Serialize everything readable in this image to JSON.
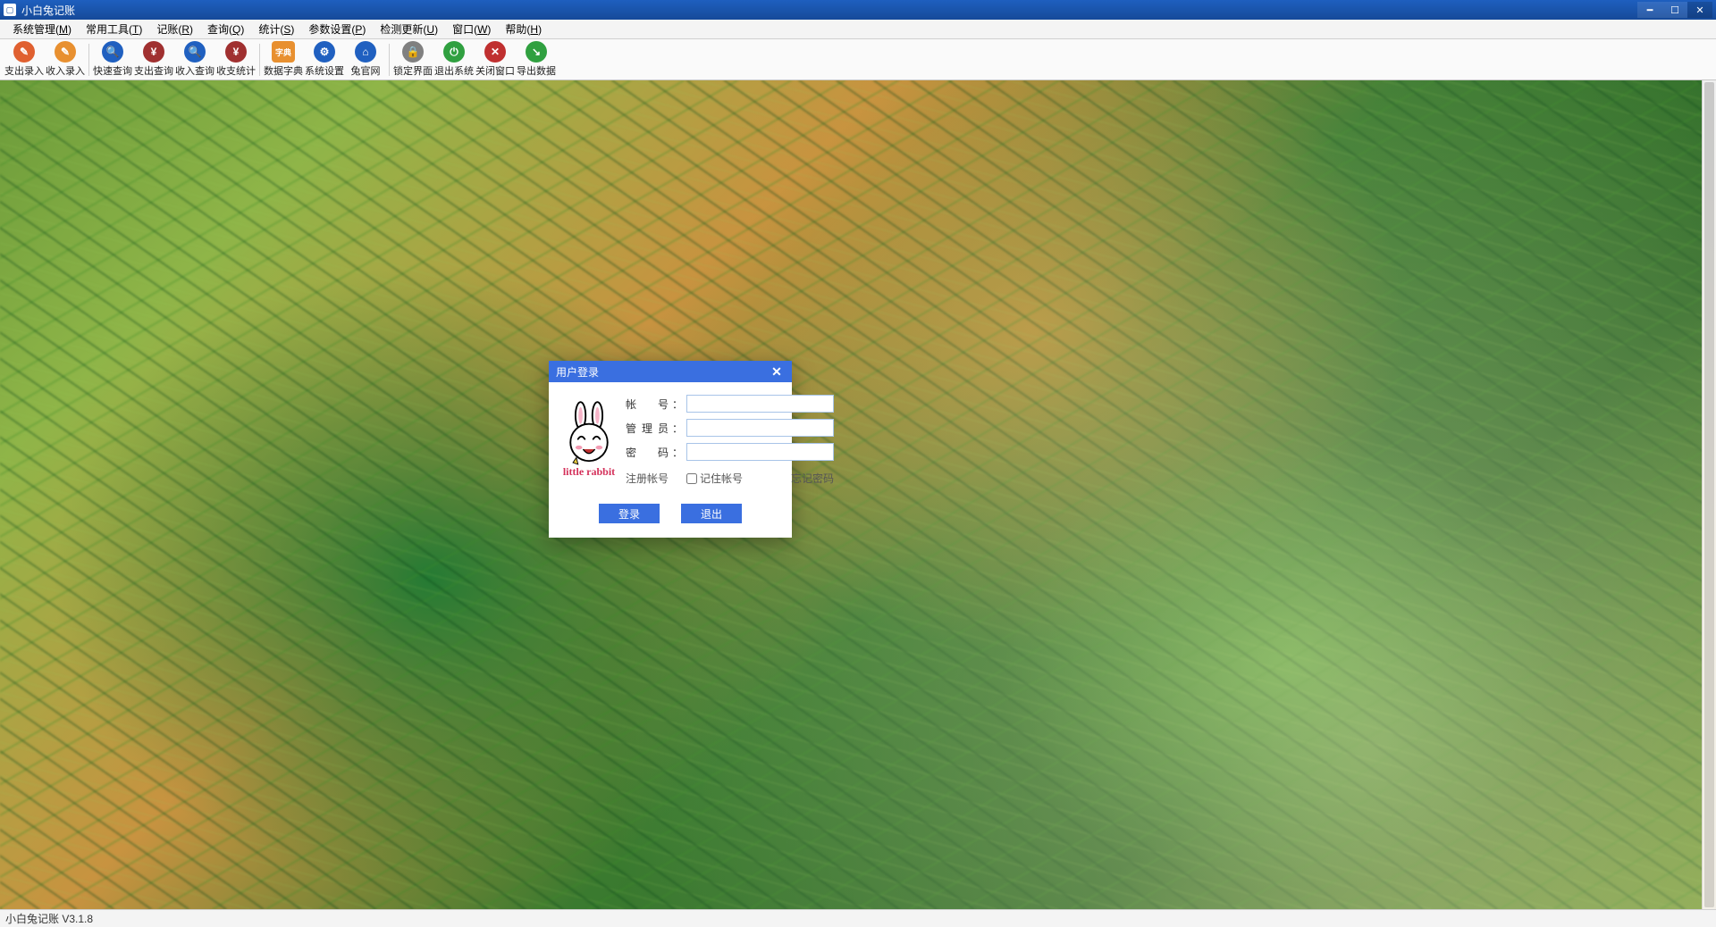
{
  "window": {
    "title": "小白兔记账"
  },
  "menu": {
    "items": [
      {
        "label": "系统管理",
        "key": "M"
      },
      {
        "label": "常用工具",
        "key": "T"
      },
      {
        "label": "记账",
        "key": "R"
      },
      {
        "label": "查询",
        "key": "Q"
      },
      {
        "label": "统计",
        "key": "S"
      },
      {
        "label": "参数设置",
        "key": "P"
      },
      {
        "label": "检测更新",
        "key": "U"
      },
      {
        "label": "窗口",
        "key": "W"
      },
      {
        "label": "帮助",
        "key": "H"
      }
    ]
  },
  "toolbar": {
    "groups": [
      [
        {
          "label": "支出录入",
          "icon": "pencil-icon",
          "color": "#e06030"
        },
        {
          "label": "收入录入",
          "icon": "folder-icon",
          "color": "#e89030"
        }
      ],
      [
        {
          "label": "快速查询",
          "icon": "search-fast-icon",
          "color": "#2060c0"
        },
        {
          "label": "支出查询",
          "icon": "search-yen-icon",
          "color": "#a03030"
        },
        {
          "label": "收入查询",
          "icon": "search-plus-icon",
          "color": "#2060c0"
        },
        {
          "label": "收支统计",
          "icon": "chart-icon",
          "color": "#a03030"
        }
      ],
      [
        {
          "label": "数据字典",
          "icon": "dict-icon",
          "color": "#e89030"
        },
        {
          "label": "系统设置",
          "icon": "gear-icon",
          "color": "#2060c0"
        },
        {
          "label": "兔官网",
          "icon": "home-icon",
          "color": "#2060c0"
        }
      ],
      [
        {
          "label": "锁定界面",
          "icon": "lock-icon",
          "color": "#808080"
        },
        {
          "label": "退出系统",
          "icon": "power-icon",
          "color": "#30a040"
        },
        {
          "label": "关闭窗口",
          "icon": "close-icon",
          "color": "#c03030"
        },
        {
          "label": "导出数据",
          "icon": "export-icon",
          "color": "#30a040"
        }
      ]
    ]
  },
  "login": {
    "title": "用户登录",
    "brand": "little rabbit",
    "fields": {
      "account_label": "帐　号",
      "admin_label": "管理员",
      "password_label": "密　码",
      "account_value": "",
      "admin_value": "",
      "password_value": ""
    },
    "links": {
      "register": "注册帐号",
      "remember": "记住帐号",
      "forgot": "忘记密码"
    },
    "buttons": {
      "login": "登录",
      "exit": "退出"
    }
  },
  "status": {
    "text": "小白兔记账 V3.1.8"
  }
}
